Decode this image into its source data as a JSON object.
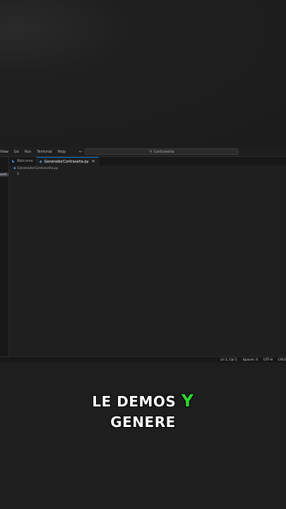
{
  "menu": [
    "View",
    "Go",
    "Run",
    "Terminal",
    "Help"
  ],
  "nav": {
    "back": "←",
    "forward": "→"
  },
  "command_center": {
    "text": "Contraseña"
  },
  "sidebar": {
    "selected_fragment": "aseñ..."
  },
  "tabs": [
    {
      "label": "Welcome",
      "icon": "vscode-icon"
    },
    {
      "label": "GeneradorContraseña.py",
      "icon": "python-icon",
      "close": "✕"
    }
  ],
  "breadcrumb": {
    "file": "GeneradorContraseña.py"
  },
  "editor": {
    "line_number": "1"
  },
  "status_bar": {
    "position": "Ln 1, Col 1",
    "spaces": "Spaces: 4",
    "encoding": "UTF-8",
    "eol": "CRLF"
  },
  "caption": {
    "line1_prefix": "LE DEMOS ",
    "line1_highlight": "Y",
    "line2": "GENERE",
    "highlight_color": "#2fd82f"
  }
}
